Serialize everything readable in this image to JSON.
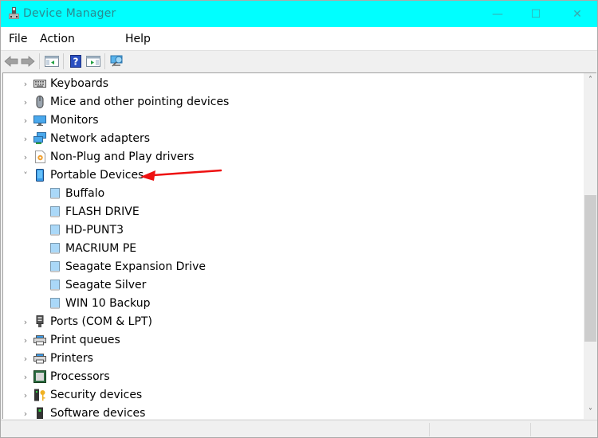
{
  "window": {
    "title": "Device Manager",
    "titlebar_color": "#00ffff",
    "controls": {
      "minimize": "—",
      "maximize": "☐",
      "close": "✕"
    }
  },
  "menubar": {
    "items": [
      {
        "label": "File"
      },
      {
        "label": "Action"
      },
      {
        "label": "Help"
      }
    ]
  },
  "toolbar": {
    "buttons": [
      {
        "name": "back",
        "icon": "back-arrow-icon"
      },
      {
        "name": "forward",
        "icon": "forward-arrow-icon"
      },
      {
        "name": "show-hide-console-tree",
        "icon": "console-tree-icon"
      },
      {
        "name": "help",
        "icon": "help-icon"
      },
      {
        "name": "show-action-pane",
        "icon": "action-pane-icon"
      },
      {
        "name": "scan-hardware",
        "icon": "scan-monitor-icon"
      }
    ]
  },
  "tree": {
    "expander_collapsed": "›",
    "expander_expanded": "˅",
    "nodes": [
      {
        "label": "Keyboards",
        "icon": "keyboard-icon",
        "expanded": false
      },
      {
        "label": "Mice and other pointing devices",
        "icon": "mouse-icon",
        "expanded": false
      },
      {
        "label": "Monitors",
        "icon": "monitor-icon",
        "expanded": false
      },
      {
        "label": "Network adapters",
        "icon": "network-adapter-icon",
        "expanded": false
      },
      {
        "label": "Non-Plug and Play drivers",
        "icon": "driver-icon",
        "expanded": false
      },
      {
        "label": "Portable Devices",
        "icon": "portable-device-icon",
        "expanded": true,
        "children": [
          {
            "label": "Buffalo"
          },
          {
            "label": "FLASH DRIVE"
          },
          {
            "label": "HD-PUNT3"
          },
          {
            "label": "MACRIUM PE"
          },
          {
            "label": "Seagate Expansion Drive"
          },
          {
            "label": "Seagate Silver"
          },
          {
            "label": "WIN 10 Backup"
          }
        ]
      },
      {
        "label": "Ports (COM & LPT)",
        "icon": "port-icon",
        "expanded": false
      },
      {
        "label": "Print queues",
        "icon": "printer-icon",
        "expanded": false
      },
      {
        "label": "Printers",
        "icon": "printer-icon",
        "expanded": false
      },
      {
        "label": "Processors",
        "icon": "processor-icon",
        "expanded": false
      },
      {
        "label": "Security devices",
        "icon": "security-device-icon",
        "expanded": false
      },
      {
        "label": "Software devices",
        "icon": "software-device-icon",
        "expanded": false
      }
    ]
  },
  "scrollbar": {
    "up": "˄",
    "down": "˅",
    "thumb_start_fraction": 0.34,
    "thumb_size_fraction": 0.46
  },
  "annotation": {
    "color": "#ee1111",
    "points_to": "Portable Devices"
  }
}
